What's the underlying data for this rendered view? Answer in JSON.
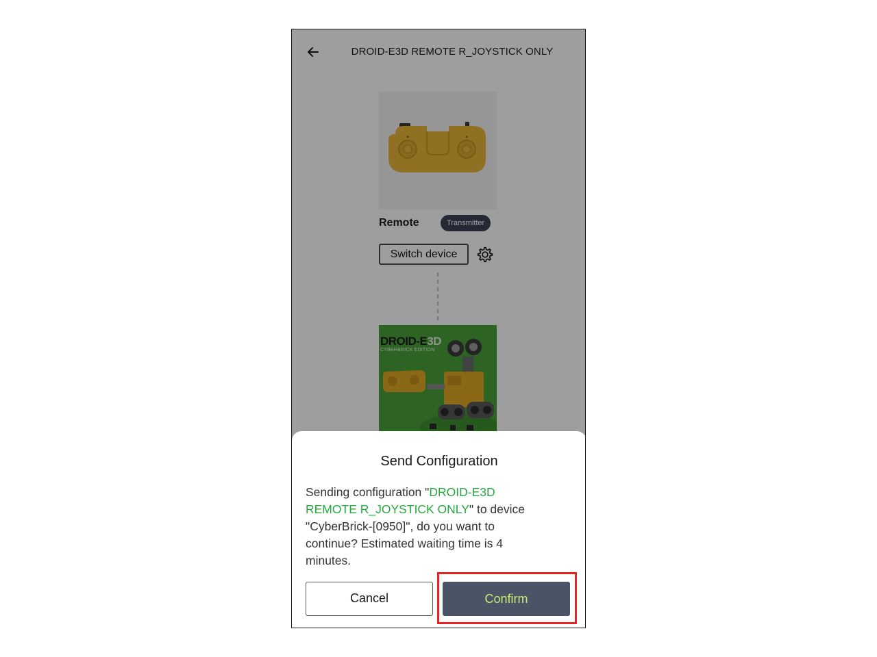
{
  "header": {
    "title": "DROID-E3D REMOTE R_JOYSTICK ONLY"
  },
  "remote_device": {
    "name": "Remote",
    "badge": "Transmitter",
    "switch_label": "Switch device"
  },
  "product": {
    "logo_main": "DROID-E",
    "logo_accent": "3D",
    "logo_sub": "CYBERBRICK EDITION"
  },
  "dialog": {
    "title": "Send Configuration",
    "message_prefix": "Sending configuration \"",
    "config_name": "DROID-E3D REMOTE R_JOYSTICK ONLY",
    "message_suffix": "\" to device \"CyberBrick-[0950]\", do you want to continue? Estimated waiting time is 4 minutes.",
    "cancel_label": "Cancel",
    "confirm_label": "Confirm"
  },
  "colors": {
    "accent_green": "#23a83e",
    "confirm_text": "#c6ef72",
    "confirm_bg": "#4b5366",
    "highlight_red": "#e32420"
  }
}
